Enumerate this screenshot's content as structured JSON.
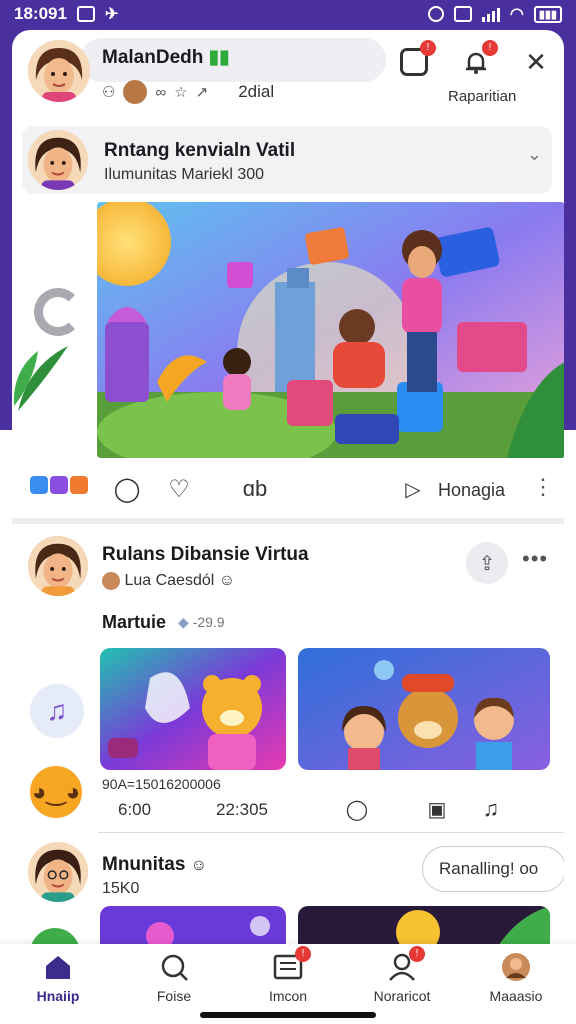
{
  "status_bar": {
    "time": "18:091"
  },
  "header": {
    "name": "MalanDedh",
    "name_suffix": "▮▮",
    "sub_count": "2dial",
    "right_label": "Raparitian"
  },
  "post1": {
    "title": "Rntang kenvialn Vatil",
    "subtitle": "Ilumunitas Mariekl 300",
    "action_label": "Honagia"
  },
  "post2": {
    "title": "Rulans Dibansie Virtua",
    "subtitle": "Lua Caesdól",
    "section_label": "Martuie",
    "section_meta": "-29.9",
    "stat_caption": "90A=15016200006",
    "stat_left": "6:00",
    "stat_right": "22:305"
  },
  "post3": {
    "title": "Mnunitas",
    "subtitle": "15K0",
    "button_label": "Ranalling! oo"
  },
  "bottom_nav": [
    {
      "label": "Hnaiip",
      "icon": "home-icon",
      "active": true
    },
    {
      "label": "Foise",
      "icon": "search-icon",
      "active": false
    },
    {
      "label": "Imcon",
      "icon": "inbox-icon",
      "active": false
    },
    {
      "label": "Noraricot",
      "icon": "contacts-icon",
      "active": false
    },
    {
      "label": "Maaasio",
      "icon": "profile-icon",
      "active": false
    }
  ],
  "colors": {
    "brand_purple": "#4a2f9e",
    "nav_active": "#3a2d8c",
    "badge_red": "#e53935"
  }
}
